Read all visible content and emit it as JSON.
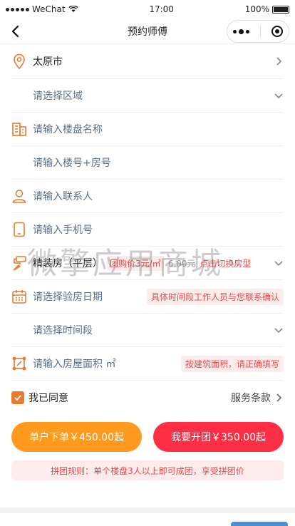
{
  "status_bar": {
    "carrier": "WeChat",
    "time": "17:00",
    "battery": "100%"
  },
  "nav": {
    "title": "预约师傅"
  },
  "form": {
    "city": "太原市",
    "region_placeholder": "请选择区域",
    "building_placeholder": "请输入楼盘名称",
    "room_placeholder": "请输入楼号+房号",
    "contact_placeholder": "请输入联系人",
    "phone_placeholder": "请输入手机号",
    "house_type": "精装房（平层）",
    "price_badge": "团购价3元/㎡",
    "price_original": "6.00元",
    "switch_hint": "点击切换房型",
    "date_placeholder": "请选择验房日期",
    "date_tag": "具体时间段工作人员与您联系确认",
    "time_placeholder": "请选择时间段",
    "area_placeholder": "请输入房屋面积 ㎡",
    "area_tag": "按建筑面积，请正确填写"
  },
  "agree": {
    "label": "我已同意",
    "terms": "服务条款"
  },
  "buttons": {
    "single": "单户下单￥450.00起",
    "group": "我要开团￥350.00起"
  },
  "rule": "拼团规则：单个楼盘3人以上即可成团，享受拼团价",
  "watermark": "微擎应用商城",
  "colors": {
    "accent": "#e97a2e",
    "orange_button": "#ff9a1f",
    "red_button": "#fe2e45",
    "tag_text": "#e8484a"
  },
  "icons": [
    "back-icon",
    "more-icon",
    "target-icon",
    "location-icon",
    "building-icon",
    "person-icon",
    "phone-icon",
    "brush-icon",
    "calendar-icon",
    "area-icon",
    "chevron-right-icon",
    "chevron-down-icon",
    "check-icon"
  ]
}
